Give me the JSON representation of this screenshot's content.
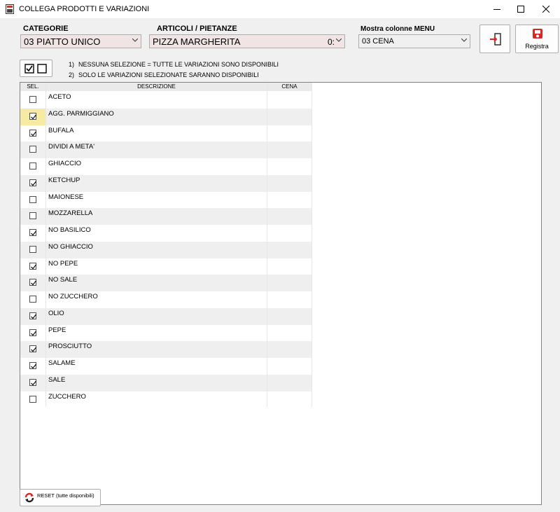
{
  "window": {
    "title": "COLLEGA PRODOTTI E VARIAZIONI"
  },
  "filters": {
    "categorie_label": "CATEGORIE",
    "categorie_value": "03 PIATTO UNICO",
    "articoli_label": "ARTICOLI / PIETANZE",
    "articoli_value": "PIZZA MARGHERITA",
    "articoli_code": "0:",
    "menu_label": "Mostra colonne MENU",
    "menu_value": "03 CENA"
  },
  "buttons": {
    "registra_label": "Registra",
    "reset_label": "RESET (tutte disponibili)"
  },
  "notes": [
    {
      "num": "1)",
      "text": "NESSUNA SELEZIONE = TUTTE LE VARIAZIONI SONO DISPONIBILI"
    },
    {
      "num": "2)",
      "text": "SOLO LE VARIAZIONI SELEZIONATE SARANNO DISPONIBILI"
    }
  ],
  "table": {
    "columns": [
      "SEL.",
      "DESCRIZIONE",
      "CENA"
    ],
    "rows": [
      {
        "desc": "ACETO",
        "checked": false
      },
      {
        "desc": "AGG. PARMIGGIANO",
        "checked": true,
        "highlighted": true
      },
      {
        "desc": "BUFALA",
        "checked": true
      },
      {
        "desc": "DIVIDI A META'",
        "checked": false
      },
      {
        "desc": "GHIACCIO",
        "checked": false
      },
      {
        "desc": "KETCHUP",
        "checked": true
      },
      {
        "desc": "MAIONESE",
        "checked": false
      },
      {
        "desc": "MOZZARELLA",
        "checked": false
      },
      {
        "desc": "NO BASILICO",
        "checked": true
      },
      {
        "desc": "NO GHIACCIO",
        "checked": false
      },
      {
        "desc": "NO PEPE",
        "checked": true
      },
      {
        "desc": "NO SALE",
        "checked": true
      },
      {
        "desc": "NO ZUCCHERO",
        "checked": false
      },
      {
        "desc": "OLIO",
        "checked": true
      },
      {
        "desc": "PEPE",
        "checked": true
      },
      {
        "desc": "PROSCIUTTO",
        "checked": true
      },
      {
        "desc": "SALAME",
        "checked": true
      },
      {
        "desc": "SALE",
        "checked": true
      },
      {
        "desc": "ZUCCHERO",
        "checked": false
      }
    ]
  },
  "icons": {
    "app": "app-icon",
    "exit": "exit-door-icon",
    "registra": "save-disk-icon",
    "toggle": "checkbox-toggle-icon",
    "reset": "reset-cycle-icon"
  }
}
